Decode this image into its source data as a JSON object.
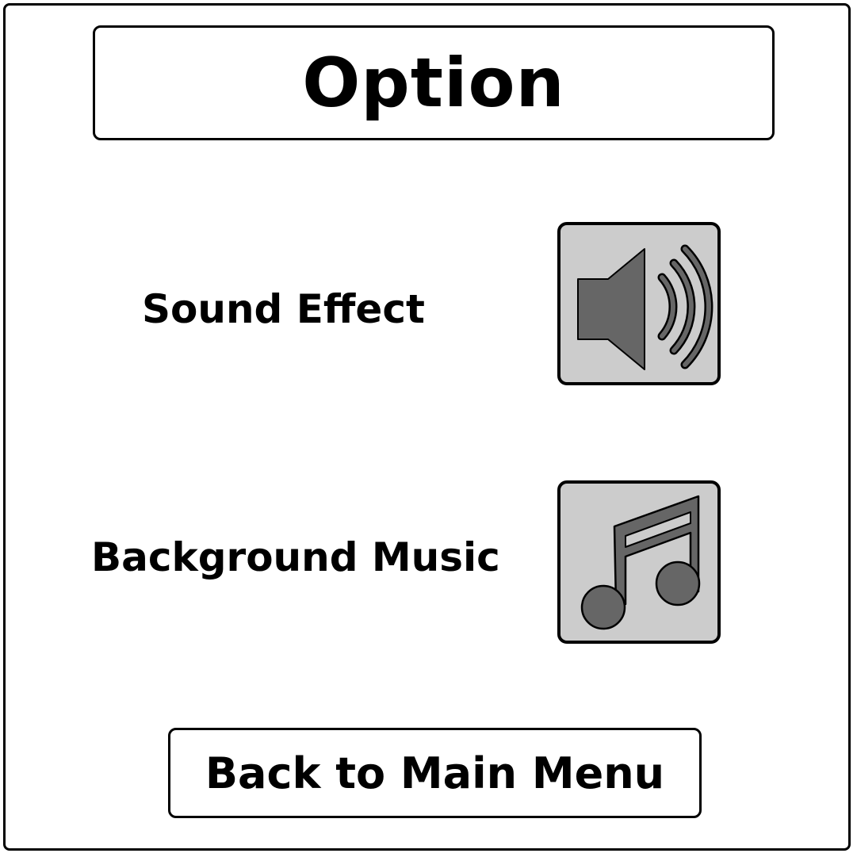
{
  "screen": {
    "title": "Option"
  },
  "settings": {
    "sound_effect": {
      "label": "Sound Effect",
      "icon": "speaker-icon"
    },
    "background_music": {
      "label": "Background Music",
      "icon": "music-note-icon"
    }
  },
  "navigation": {
    "back_label": "Back to Main Menu"
  },
  "colors": {
    "icon_button_background": "#cccccc",
    "icon_glyph": "#666666",
    "outline": "#000000"
  }
}
